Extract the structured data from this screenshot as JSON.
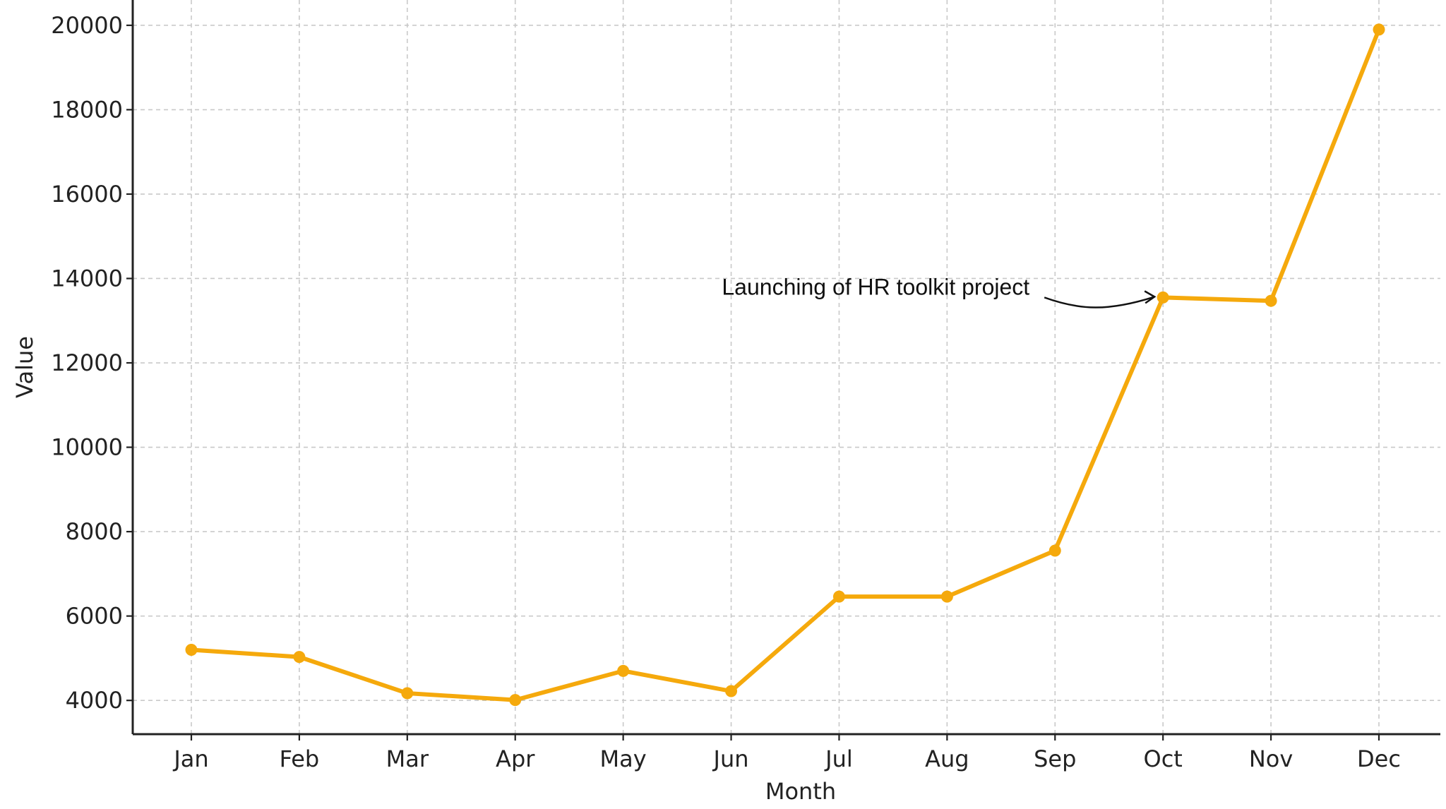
{
  "chart_data": {
    "type": "line",
    "title": "",
    "xlabel": "Month",
    "ylabel": "Value",
    "categories": [
      "Jan",
      "Feb",
      "Mar",
      "Apr",
      "May",
      "Jun",
      "Jul",
      "Aug",
      "Sep",
      "Oct",
      "Nov",
      "Dec"
    ],
    "series": [
      {
        "values": [
          5200,
          5030,
          4170,
          4010,
          4700,
          4220,
          6460,
          6460,
          7550,
          13550,
          13470,
          19900
        ],
        "color": "#f5a90c"
      }
    ],
    "ylim": [
      3200,
      20600
    ],
    "yticks": [
      4000,
      6000,
      8000,
      10000,
      12000,
      14000,
      16000,
      18000,
      20000
    ],
    "ytick_labels": [
      "4000",
      "6000",
      "8000",
      "10000",
      "12000",
      "14000",
      "16000",
      "18000",
      "20000"
    ],
    "grid": true,
    "legend": "none",
    "annotation": {
      "text": "Launching of HR toolkit project",
      "target_category": "Oct",
      "target_value": 13550
    }
  }
}
